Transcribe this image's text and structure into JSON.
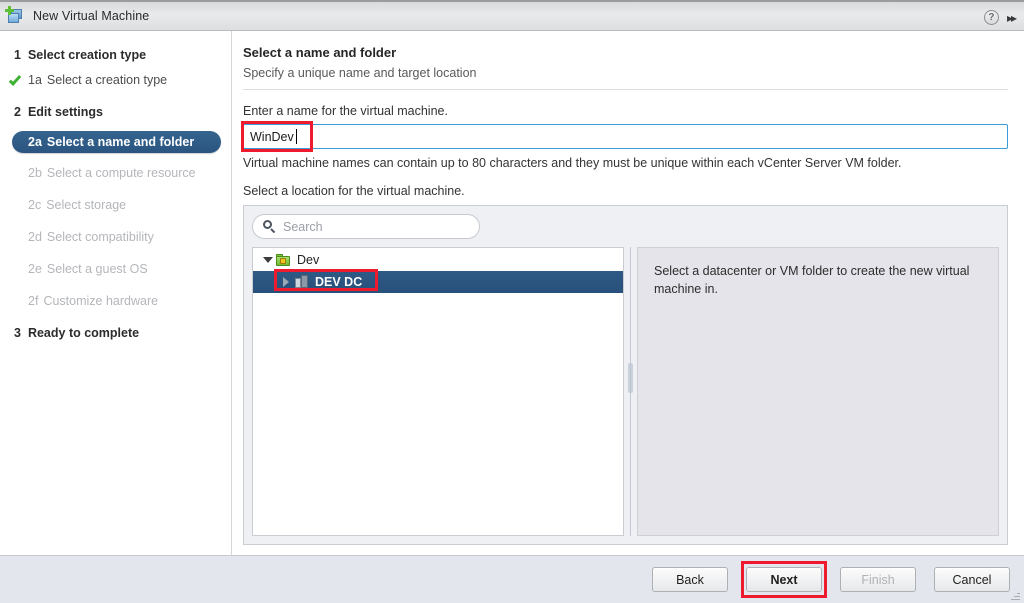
{
  "window": {
    "title": "New Virtual Machine",
    "icon": "new-vm-icon",
    "help_icon": "?",
    "expand_icon": "▸▸"
  },
  "sidebar": {
    "items": [
      {
        "num": "1",
        "label": "Select creation type",
        "type": "group",
        "state": "normal",
        "check": false
      },
      {
        "num": "1a",
        "label": "Select a creation type",
        "type": "sub",
        "state": "done",
        "check": true
      },
      {
        "num": "2",
        "label": "Edit settings",
        "type": "group",
        "state": "normal",
        "check": false
      },
      {
        "num": "2a",
        "label": "Select a name and folder",
        "type": "sub",
        "state": "selected",
        "check": false
      },
      {
        "num": "2b",
        "label": "Select a compute resource",
        "type": "sub",
        "state": "disabled",
        "check": false
      },
      {
        "num": "2c",
        "label": "Select storage",
        "type": "sub",
        "state": "disabled",
        "check": false
      },
      {
        "num": "2d",
        "label": "Select compatibility",
        "type": "sub",
        "state": "disabled",
        "check": false
      },
      {
        "num": "2e",
        "label": "Select a guest OS",
        "type": "sub",
        "state": "disabled",
        "check": false
      },
      {
        "num": "2f",
        "label": "Customize hardware",
        "type": "sub",
        "state": "disabled",
        "check": false
      },
      {
        "num": "3",
        "label": "Ready to complete",
        "type": "group",
        "state": "normal",
        "check": false
      }
    ]
  },
  "main": {
    "title": "Select a name and folder",
    "subtitle": "Specify a unique name and target location",
    "name_label": "Enter a name for the virtual machine.",
    "name_value": "WinDev",
    "name_placeholder": "",
    "name_helper": "Virtual machine names can contain up to 80 characters and they must be unique within each vCenter Server VM folder.",
    "location_label": "Select a location for the virtual machine.",
    "search_placeholder": "Search",
    "search_value": "",
    "search_icon": "search-icon",
    "tree": [
      {
        "label": "Dev",
        "icon": "green-folder-icon",
        "depth": 0,
        "expanded": true,
        "selected": false,
        "twisty": "chevron-down-icon"
      },
      {
        "label": "DEV DC",
        "icon": "datacenter-icon",
        "depth": 1,
        "expanded": false,
        "selected": true,
        "twisty": "chevron-right-icon"
      }
    ],
    "detail_text": "Select a datacenter or VM folder to create the new virtual machine in."
  },
  "footer": {
    "buttons": [
      {
        "label": "Back",
        "state": "enabled",
        "highlight": false
      },
      {
        "label": "Next",
        "state": "enabled",
        "highlight": true
      },
      {
        "label": "Finish",
        "state": "disabled",
        "highlight": false
      },
      {
        "label": "Cancel",
        "state": "enabled",
        "highlight": false
      }
    ]
  },
  "annotations": {
    "color": "#ee1b2e",
    "targets": [
      "name-input",
      "tree-row-dev-dc",
      "next-button"
    ]
  },
  "colors": {
    "selected_nav": "#2b5580",
    "tree_selection": "#27507a",
    "input_focus_border": "#3a9cd9",
    "check_green": "#3fb133",
    "annotation_red": "#ee1b2e",
    "footer_bg": "#e3e6ec",
    "detail_bg": "#e4e4ea",
    "picker_bg": "#eef0f3"
  }
}
